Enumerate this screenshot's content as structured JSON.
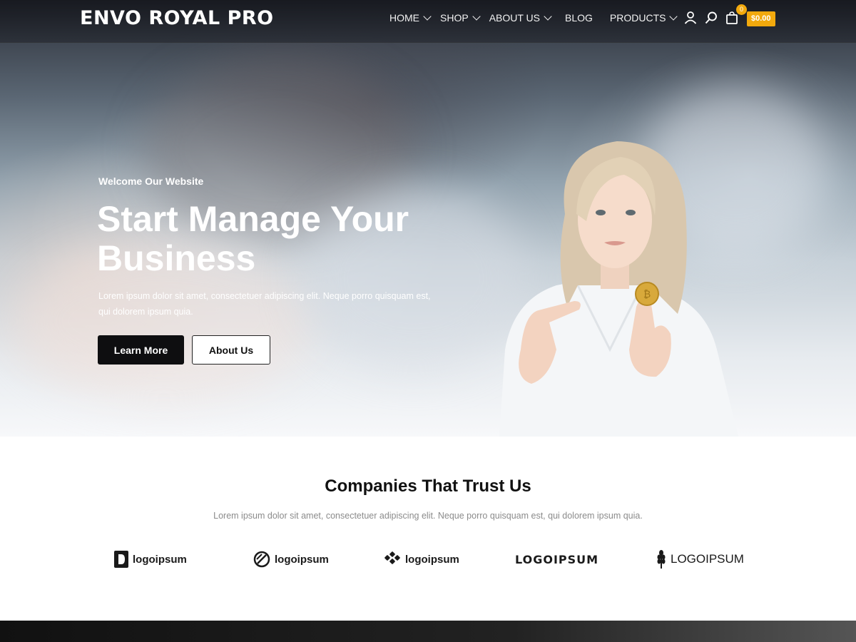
{
  "header": {
    "logo": "ENVO ROYAL PRO",
    "nav": [
      {
        "label": "HOME",
        "dropdown": true
      },
      {
        "label": "SHOP",
        "dropdown": true
      },
      {
        "label": "ABOUT US",
        "dropdown": true
      },
      {
        "label": "BLOG",
        "dropdown": false
      },
      {
        "label": "PRODUCTS",
        "dropdown": true
      }
    ],
    "icons": [
      "user-icon",
      "search-icon",
      "shopping-bag-icon"
    ],
    "cart_count": "0",
    "cart_total": "$0.00",
    "accent_color": "#f2a90d"
  },
  "hero": {
    "eyebrow": "Welcome Our Website",
    "title_line1": "Start Manage Your",
    "title_line2": "Business",
    "text": "Lorem ipsum dolor sit amet, consectetuer adipiscing elit. Neque porro quisquam est, qui dolorem ipsum quia.",
    "primary_button": "Learn More",
    "secondary_button": "About Us"
  },
  "companies": {
    "title": "Companies That Trust Us",
    "text": "Lorem ipsum dolor sit amet, consectetuer adipiscing elit. Neque porro quisquam est, qui dolorem ipsum quia.",
    "logos": [
      {
        "text": "logoipsum",
        "icon": "logo-mark-d-icon"
      },
      {
        "text": "logoipsum",
        "icon": "logo-mark-circle-slash-icon"
      },
      {
        "text": "logoipsum",
        "icon": "logo-mark-chain-icon"
      },
      {
        "text": "LOGOIPSUM",
        "icon": "logo-wordmark"
      },
      {
        "text": "LOGOIPSUM",
        "icon": "logo-mark-wheat-icon"
      }
    ]
  }
}
